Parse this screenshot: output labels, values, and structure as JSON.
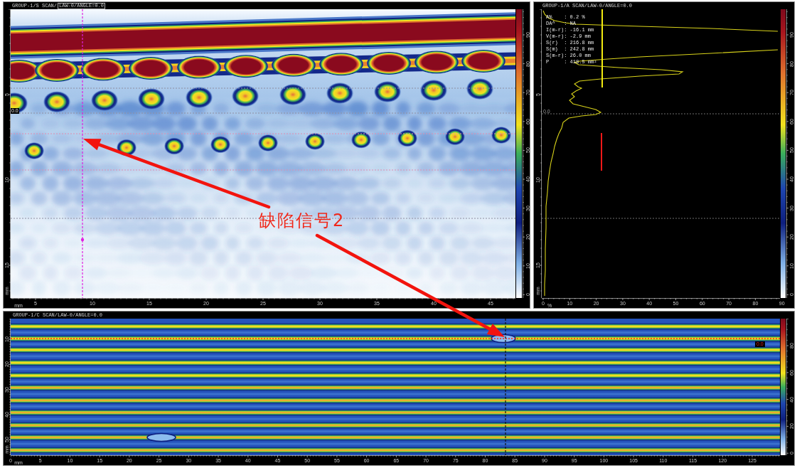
{
  "s_scan": {
    "title": "GROUP-1/S SCAN/",
    "law": "LAW-0/ANGLE=0.0",
    "cursor_value": "0.0",
    "depth_labels": [
      "5",
      "10",
      "15"
    ],
    "depth_unit": "mm",
    "scan_labels": [
      "5",
      "10",
      "15",
      "20",
      "25",
      "30",
      "35",
      "40",
      "45"
    ],
    "scan_unit": "mm",
    "scale_labels": [
      "90",
      "80",
      "70",
      "60",
      "50",
      "40",
      "30",
      "20",
      "10",
      "0"
    ]
  },
  "a_scan": {
    "title": "GROUP-1/A SCAN/LAW-0/ANGLE=0.0",
    "readings": [
      "A%    : 0.2 %",
      "DA^   : NA",
      "I(m-r): -16.1 mm",
      "V(m-r): -2.9 mm",
      "S(r)  : 216.8 mm",
      "S(m)  : 242.8 mm",
      "S(m-r): 26.0 mm",
      "P     : 418.5 mm²"
    ],
    "cursor_value": "0.0",
    "depth_labels": [
      "5",
      "10",
      "15"
    ],
    "depth_unit": "mm",
    "amplitude_labels": [
      "0",
      "10",
      "20",
      "30",
      "40",
      "50",
      "60",
      "70",
      "80",
      "90"
    ],
    "amplitude_unit": "%",
    "scale_labels": [
      "90",
      "80",
      "70",
      "60",
      "50",
      "40",
      "30",
      "20",
      "10",
      "0"
    ]
  },
  "c_scan": {
    "title": "GROUP-1/C SCAN/LAW-0/ANGLE=0.0",
    "cursor_value": "0.0",
    "index_labels": [
      "10",
      "20",
      "30",
      "40",
      "50"
    ],
    "index_unit": "mm",
    "scan_labels": [
      "0",
      "5",
      "10",
      "15",
      "20",
      "25",
      "30",
      "35",
      "40",
      "45",
      "50",
      "55",
      "60",
      "65",
      "70",
      "75",
      "80",
      "85",
      "90",
      "95",
      "100",
      "105",
      "110",
      "115",
      "120",
      "125"
    ],
    "scan_unit": "mm",
    "scale_labels": [
      "80",
      "60",
      "40",
      "20",
      "0"
    ]
  },
  "annotation": {
    "text": "缺陷信号2"
  }
}
